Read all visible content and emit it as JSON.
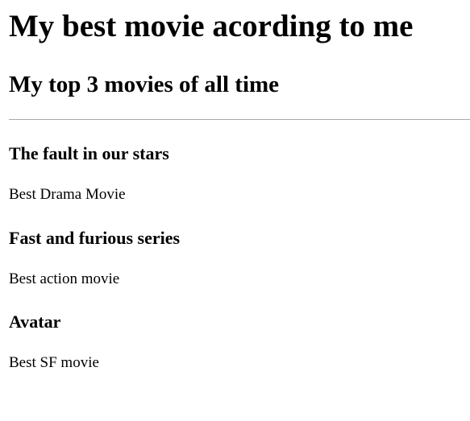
{
  "header": {
    "title": "My best movie acording to me",
    "subtitle": "My top 3 movies of all time"
  },
  "movies": [
    {
      "title": "The fault in our stars",
      "description": "Best Drama Movie"
    },
    {
      "title": "Fast and furious series",
      "description": "Best action movie"
    },
    {
      "title": "Avatar",
      "description": "Best SF movie"
    }
  ],
  "colors": {
    "text": "#000000",
    "background": "#ffffff",
    "divider": "#a8a8a8"
  }
}
